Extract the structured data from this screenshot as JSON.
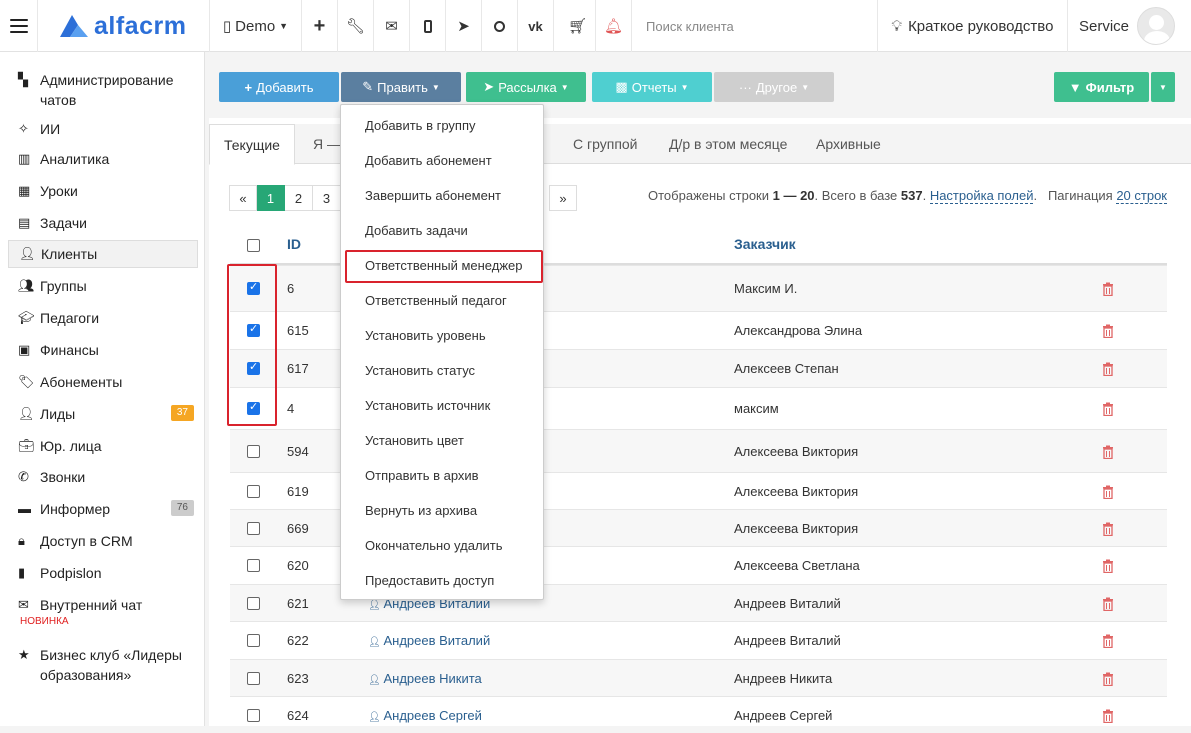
{
  "header": {
    "logo_text": "alfacrm",
    "company": "Demo",
    "search_placeholder": "Поиск клиента",
    "guide_label": "Краткое руководство",
    "user_label": "Service",
    "icons": [
      "plus-icon",
      "wrench-icon",
      "mail-icon",
      "phone-icon",
      "telegram-icon",
      "whatsapp-icon",
      "vk-icon",
      "cart-icon",
      "bell-icon"
    ]
  },
  "sidebar": {
    "items": [
      {
        "label": "Администрирование чатов",
        "icon": "chat-admin-icon"
      },
      {
        "label": "ИИ",
        "icon": "ai-icon"
      },
      {
        "label": "Аналитика",
        "icon": "analytics-icon"
      },
      {
        "label": "Уроки",
        "icon": "calendar-icon"
      },
      {
        "label": "Задачи",
        "icon": "tasks-icon"
      },
      {
        "label": "Клиенты",
        "icon": "client-icon"
      },
      {
        "label": "Группы",
        "icon": "groups-icon"
      },
      {
        "label": "Педагоги",
        "icon": "teacher-icon"
      },
      {
        "label": "Финансы",
        "icon": "money-icon"
      },
      {
        "label": "Абонементы",
        "icon": "tag-icon"
      },
      {
        "label": "Лиды",
        "icon": "lead-icon",
        "badge": "37"
      },
      {
        "label": "Юр. лица",
        "icon": "briefcase-icon"
      },
      {
        "label": "Звонки",
        "icon": "call-icon"
      },
      {
        "label": "Информер",
        "icon": "informer-icon",
        "badge": "76"
      },
      {
        "label": "Доступ в CRM",
        "icon": "lock-icon"
      },
      {
        "label": "Podpislon",
        "icon": "doc-icon"
      },
      {
        "label": "Внутренний чат",
        "icon": "envelope-icon",
        "sub": "НОВИНКА"
      },
      {
        "label": "Бизнес клуб «Лидеры образования»",
        "icon": "star-icon"
      }
    ]
  },
  "toolbar": {
    "add": "Добавить",
    "edit": "Править",
    "mailing": "Рассылка",
    "reports": "Отчеты",
    "other": "Другое",
    "filter": "Фильтр"
  },
  "tabs": [
    "Текущие",
    "Я —",
    "С группой",
    "Д/р в этом месяце",
    "Архивные"
  ],
  "pager": {
    "prev": "«",
    "pages": [
      "1",
      "2",
      "3"
    ],
    "next": "»",
    "info_prefix": "Отображены строки ",
    "range": "1 — 20",
    "info_mid": ". Всего в базе ",
    "total": "537",
    "info_dot": ".",
    "fields_link": "Настройка полей",
    "pagination_label": "Пагинация",
    "pagination_link": "20 строк"
  },
  "table": {
    "col_id": "ID",
    "col_customer": "Заказчик",
    "rows": [
      {
        "id": "6",
        "name": "",
        "customer": "Максим И.",
        "checked": true
      },
      {
        "id": "615",
        "name": "",
        "customer": "Александрова Элина",
        "checked": true
      },
      {
        "id": "617",
        "name": "",
        "customer": "Алексеев Степан",
        "checked": true
      },
      {
        "id": "4",
        "name": "",
        "customer": "максим",
        "checked": true
      },
      {
        "id": "594",
        "name": "",
        "customer": "Алексеева Виктория",
        "checked": false
      },
      {
        "id": "619",
        "name": "",
        "customer": "Алексеева Виктория",
        "checked": false
      },
      {
        "id": "669",
        "name": "",
        "customer": "Алексеева Виктория",
        "checked": false
      },
      {
        "id": "620",
        "name": "",
        "customer": "Алексеева Светлана",
        "checked": false
      },
      {
        "id": "621",
        "name": "Андреев Виталий",
        "customer": "Андреев Виталий",
        "checked": false
      },
      {
        "id": "622",
        "name": "Андреев Виталий",
        "customer": "Андреев Виталий",
        "checked": false
      },
      {
        "id": "623",
        "name": "Андреев Никита",
        "customer": "Андреев Никита",
        "checked": false
      },
      {
        "id": "624",
        "name": "Андреев Сергей",
        "customer": "Андреев Сергей",
        "checked": false
      }
    ]
  },
  "dropdown": {
    "items": [
      "Добавить в группу",
      "Добавить абонемент",
      "Завершить абонемент",
      "Добавить задачи",
      "Ответственный менеджер",
      "Ответственный педагог",
      "Установить уровень",
      "Установить статус",
      "Установить источник",
      "Установить цвет",
      "Отправить в архив",
      "Вернуть из архива",
      "Окончательно удалить",
      "Предоставить доступ"
    ]
  },
  "colors": {
    "add": "#4a9fd8",
    "edit": "#5b7fa0",
    "mailing": "#3fbf8f",
    "reports": "#4fcfd0",
    "other": "#cfcfcf",
    "filter": "#3fbf8f",
    "highlight": "#d9232d"
  }
}
